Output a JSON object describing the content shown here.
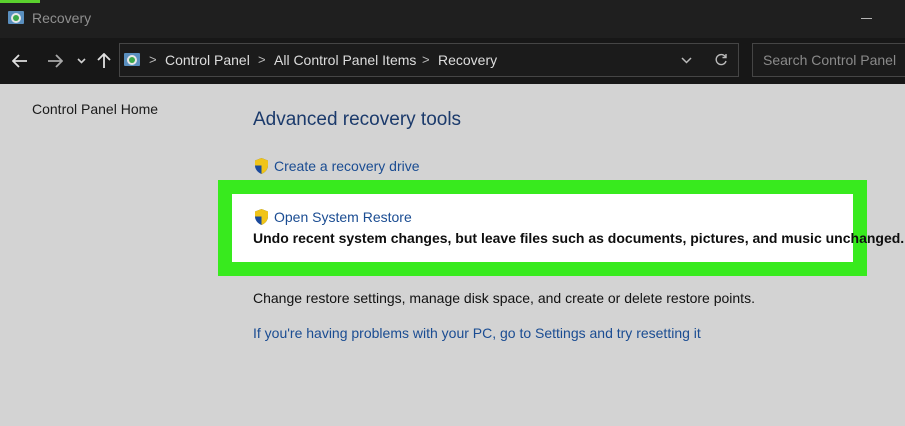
{
  "window": {
    "title": "Recovery"
  },
  "navbar": {
    "back_icon": "back-arrow-icon",
    "forward_icon": "forward-arrow-icon",
    "recent_icon": "chevron-down-icon",
    "up_icon": "up-arrow-icon",
    "breadcrumbs": [
      "Control Panel",
      "All Control Panel Items",
      "Recovery"
    ],
    "search_placeholder": "Search Control Panel"
  },
  "sidebar": {
    "home_label": "Control Panel Home"
  },
  "main": {
    "heading": "Advanced recovery tools",
    "tools": [
      {
        "label": "Create a recovery drive",
        "description": ""
      },
      {
        "label": "Open System Restore",
        "description": "Undo recent system changes, but leave files such as documents, pictures, and music unchanged."
      },
      {
        "label": "",
        "description": "Change restore settings, manage disk space, and create or delete restore points."
      }
    ],
    "reset_link": "If you're having problems with your PC, go to Settings and try resetting it"
  },
  "colors": {
    "highlight_border": "#38ea1e",
    "link": "#1a4c92",
    "heading": "#1b3a6b",
    "content_bg": "#d3d3d3",
    "titlebar_bg": "#1f1f1f"
  }
}
